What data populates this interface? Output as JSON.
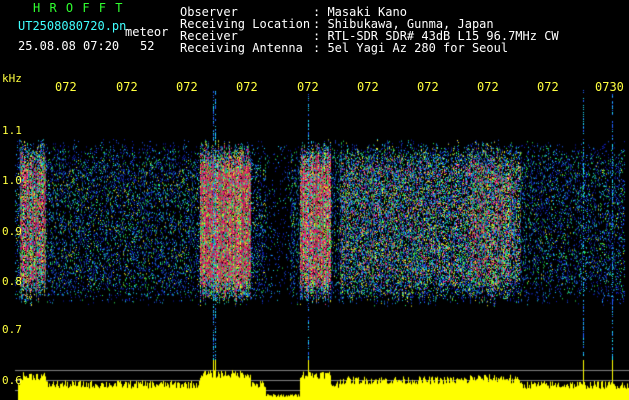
{
  "header": {
    "app_title": "H R O F F T",
    "filename": "UT2508080720.pn",
    "mode": "meteor",
    "date_time": "25.08.08 07:20",
    "count": "52",
    "info_labels": [
      "Observer",
      "Receiving Location",
      "Receiver",
      "Receiving Antenna"
    ],
    "info_values": [
      ": Masaki Kano",
      ": Shibukawa, Gunma, Japan",
      ": RTL-SDR SDR# 43dB L15 96.7MHz CW",
      ": 5el Yagi Az 280 for Seoul"
    ]
  },
  "time_axis": {
    "labels": [
      "072",
      "072",
      "072",
      "072",
      "072",
      "072",
      "072",
      "072",
      "072",
      "0730"
    ]
  },
  "freq_axis": {
    "unit": "kHz",
    "labels": [
      "1.1",
      "1.0",
      "0.9",
      "0.8",
      "0.7",
      "0.6"
    ]
  },
  "colors": {
    "background": "#000000",
    "noise_blue": "#0030ff",
    "meteor_red": "#ff2060",
    "power_yellow": "#ffff00"
  }
}
